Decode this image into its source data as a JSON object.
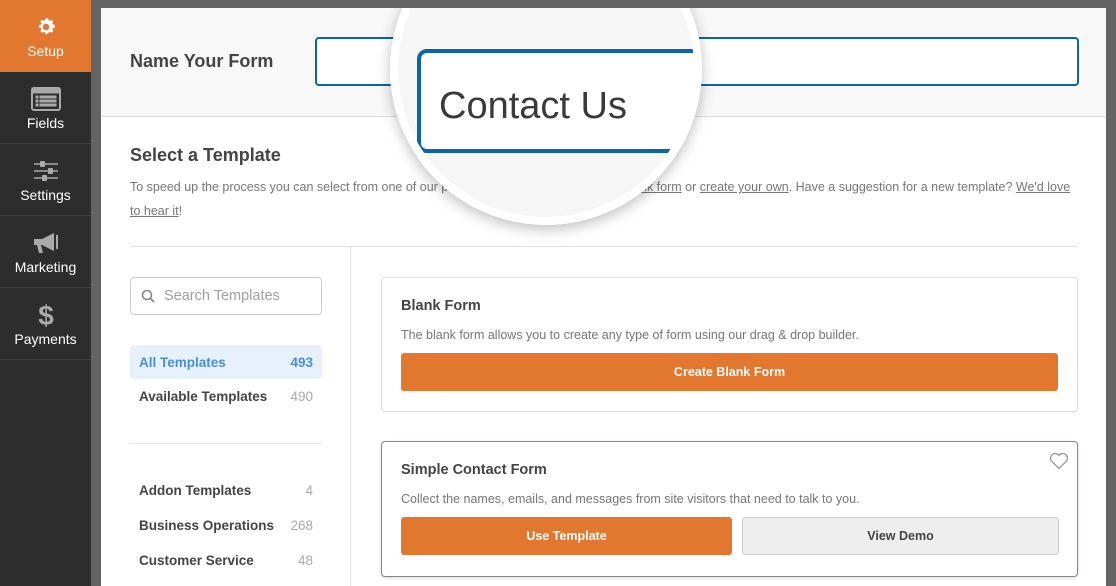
{
  "sidebar": {
    "items": [
      {
        "label": "Setup",
        "icon": "gear-icon",
        "active": true
      },
      {
        "label": "Fields",
        "icon": "fields-list-icon",
        "active": false
      },
      {
        "label": "Settings",
        "icon": "sliders-icon",
        "active": false
      },
      {
        "label": "Marketing",
        "icon": "megaphone-icon",
        "active": false
      },
      {
        "label": "Payments",
        "icon": "dollar-icon",
        "active": false
      }
    ]
  },
  "header": {
    "label": "Name Your Form",
    "form_name_value": "Contact Us"
  },
  "templates": {
    "title": "Select a Template",
    "desc_part1": "To speed up the process you can select from one of our pre-made templates, start with a ",
    "link_blank": "blank form",
    "desc_or": " or ",
    "link_create": "create your own",
    "desc_part2": ". Have a suggestion for a new template? ",
    "link_hear": "We'd love to hear it",
    "desc_end": "!",
    "search_placeholder": "Search Templates",
    "filters": [
      {
        "label": "All Templates",
        "count": "493",
        "active": true
      },
      {
        "label": "Available Templates",
        "count": "490",
        "active": false
      }
    ],
    "categories": [
      {
        "label": "Addon Templates",
        "count": "4"
      },
      {
        "label": "Business Operations",
        "count": "268"
      },
      {
        "label": "Customer Service",
        "count": "48"
      }
    ],
    "cards": [
      {
        "title": "Blank Form",
        "desc": "The blank form allows you to create any type of form using our drag & drop builder.",
        "primary_button": "Create Blank Form"
      },
      {
        "title": "Simple Contact Form",
        "desc": "Collect the names, emails, and messages from site visitors that need to talk to you.",
        "primary_button": "Use Template",
        "secondary_button": "View Demo",
        "favorite_icon": "heart-icon"
      }
    ]
  },
  "colors": {
    "accent_orange": "#e27730",
    "focus_blue": "#0e64a9",
    "sidebar_bg": "#2d2d2d",
    "active_filter_text": "#4a8fd6"
  }
}
